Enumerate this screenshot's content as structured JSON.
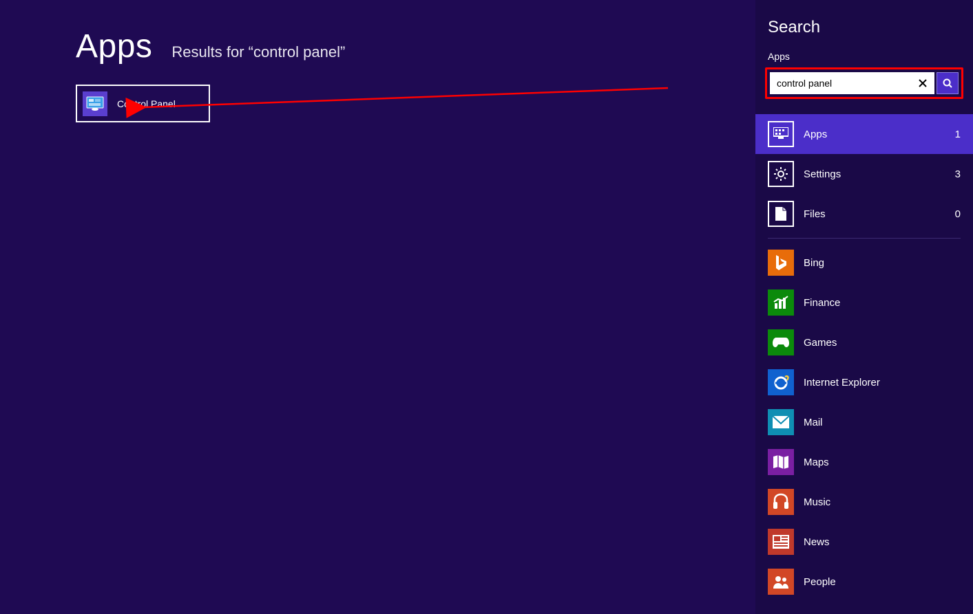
{
  "main": {
    "title": "Apps",
    "subtitle": "Results for “control panel”",
    "result": {
      "label": "Control Panel"
    }
  },
  "sidebar": {
    "title": "Search",
    "scope_label": "Apps",
    "search_value": "control panel",
    "categories": [
      {
        "label": "Apps",
        "count": "1",
        "selected": true,
        "icon": "apps-icon"
      },
      {
        "label": "Settings",
        "count": "3",
        "selected": false,
        "icon": "settings-icon"
      },
      {
        "label": "Files",
        "count": "0",
        "selected": false,
        "icon": "files-icon"
      }
    ],
    "apps": [
      {
        "label": "Bing",
        "icon_class": "ic-bing",
        "icon": "bing-icon"
      },
      {
        "label": "Finance",
        "icon_class": "ic-finance",
        "icon": "finance-icon"
      },
      {
        "label": "Games",
        "icon_class": "ic-games",
        "icon": "games-icon"
      },
      {
        "label": "Internet Explorer",
        "icon_class": "ic-ie",
        "icon": "ie-icon"
      },
      {
        "label": "Mail",
        "icon_class": "ic-mail",
        "icon": "mail-icon"
      },
      {
        "label": "Maps",
        "icon_class": "ic-maps",
        "icon": "maps-icon"
      },
      {
        "label": "Music",
        "icon_class": "ic-music",
        "icon": "music-icon"
      },
      {
        "label": "News",
        "icon_class": "ic-news",
        "icon": "news-icon"
      },
      {
        "label": "People",
        "icon_class": "ic-people",
        "icon": "people-icon"
      }
    ]
  },
  "colors": {
    "bg": "#1f0a53",
    "sidebar_bg": "#1a0947",
    "accent": "#4b2ec9",
    "annotation": "#ff0000"
  }
}
